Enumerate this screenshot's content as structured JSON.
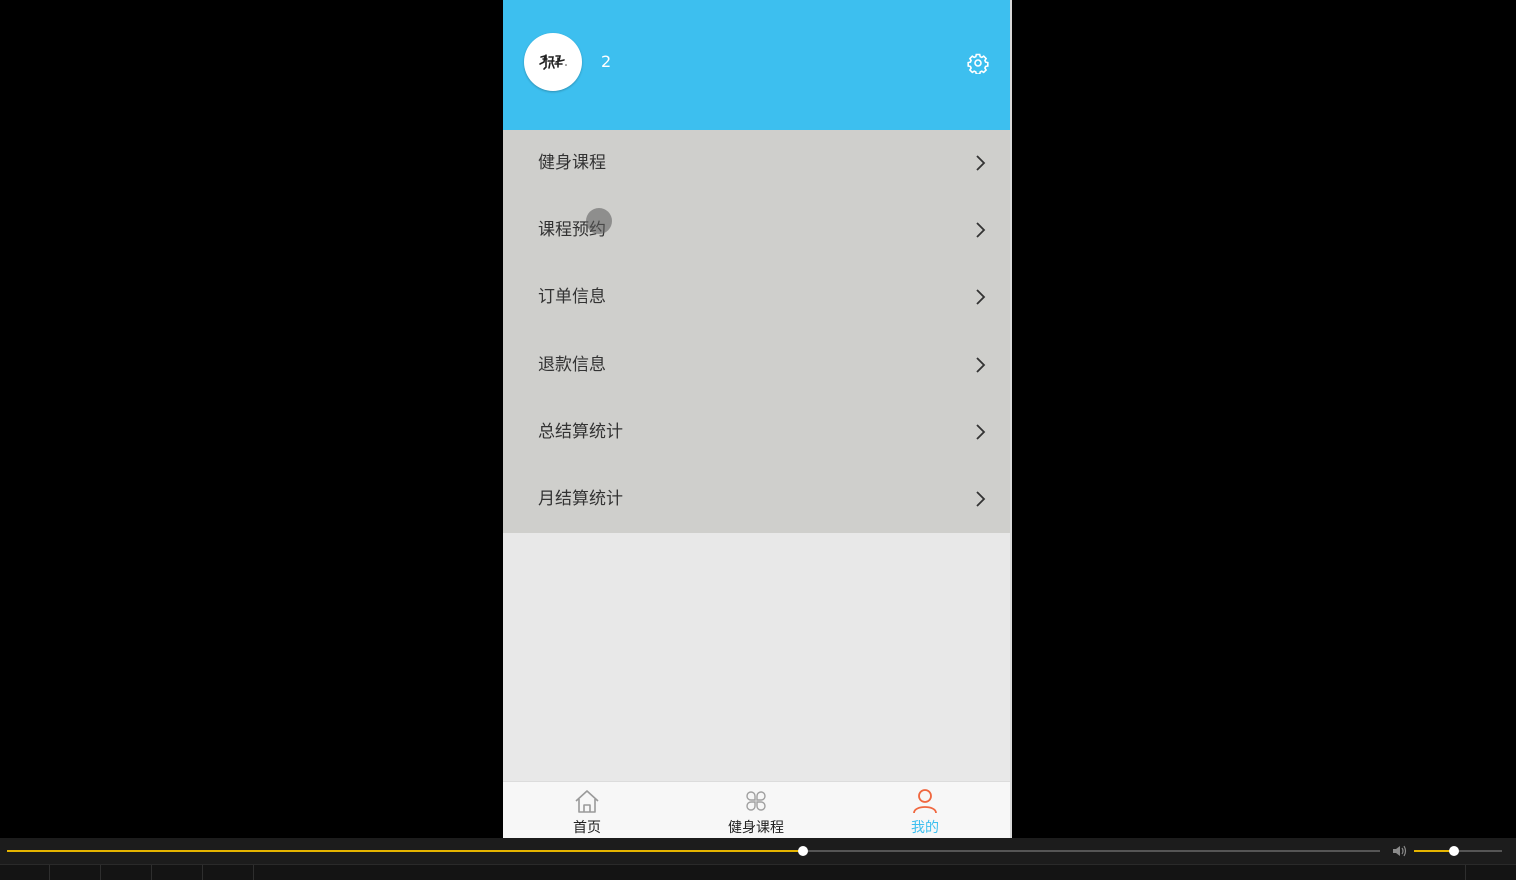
{
  "profile": {
    "username": "2",
    "avatar_icon": "avatar-logo-icon",
    "settings_icon": "gear-icon",
    "header_color": "#3dbfef"
  },
  "menu": {
    "items": [
      {
        "label": "健身课程",
        "icon": "chevron-right-icon"
      },
      {
        "label": "课程预约",
        "icon": "chevron-right-icon"
      },
      {
        "label": "订单信息",
        "icon": "chevron-right-icon"
      },
      {
        "label": "退款信息",
        "icon": "chevron-right-icon"
      },
      {
        "label": "总结算统计",
        "icon": "chevron-right-icon"
      },
      {
        "label": "月结算统计",
        "icon": "chevron-right-icon"
      }
    ]
  },
  "tabbar": {
    "active_index": 2,
    "active_color": "#3dbfef",
    "items": [
      {
        "label": "首页",
        "icon": "home-icon"
      },
      {
        "label": "健身课程",
        "icon": "grid-icon"
      },
      {
        "label": "我的",
        "icon": "user-icon"
      }
    ]
  },
  "player": {
    "progress_fraction": 0.58,
    "volume_fraction": 0.45,
    "accent_color": "#e5b400",
    "volume_icon": "volume-icon"
  }
}
